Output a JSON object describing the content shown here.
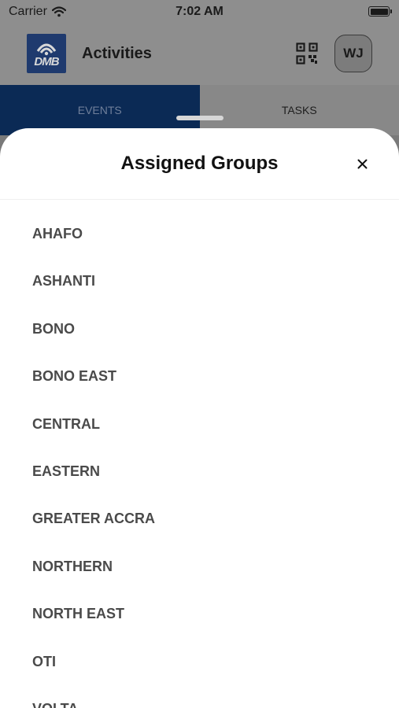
{
  "status_bar": {
    "carrier": "Carrier",
    "time": "7:02 AM"
  },
  "header": {
    "logo_text": "DMB",
    "title": "Activities",
    "avatar_initials": "WJ",
    "qr_icon": "qr-code-icon"
  },
  "tabs": [
    {
      "label": "EVENTS",
      "active": true
    },
    {
      "label": "TASKS",
      "active": false
    }
  ],
  "sheet": {
    "title": "Assigned Groups",
    "close_icon": "close-icon",
    "groups": [
      "AHAFO",
      "ASHANTI",
      "BONO",
      "BONO EAST",
      "CENTRAL",
      "EASTERN",
      "GREATER ACCRA",
      "NORTHERN",
      "NORTH EAST",
      "OTI",
      "VOLTA"
    ]
  },
  "colors": {
    "tab_active_bg": "#0b2a55",
    "overlay": "#8e8e8e",
    "sheet_bg": "#ffffff",
    "list_text": "#4a4a4a"
  }
}
